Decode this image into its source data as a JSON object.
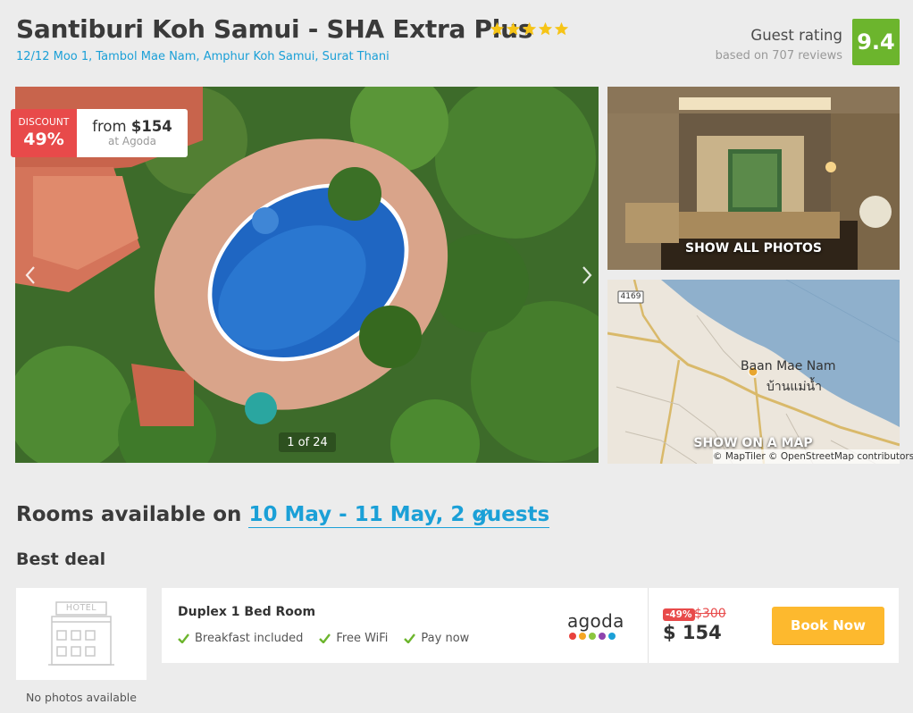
{
  "hotel": {
    "name": "Santiburi Koh Samui - SHA Extra Plus",
    "stars": 5,
    "address": "12/12 Moo 1, Tambol Mae Nam, Amphur Koh Samui, Surat Thani",
    "rating_label": "Guest rating",
    "rating_reviews": "based on 707 reviews",
    "rating_score": "9.4"
  },
  "gallery": {
    "discount_label": "DISCOUNT",
    "discount_pct": "49%",
    "from_price": "from $154",
    "from_source": "at Agoda",
    "counter": "1 of 24",
    "show_all_photos": "SHOW ALL PHOTOS",
    "show_on_map": "SHOW ON A MAP",
    "map_credit": "© MapTiler © OpenStreetMap contributors",
    "map_place_en": "Baan Mae Nam",
    "map_place_th": "บ้านแม่น้ำ",
    "map_road": "4169"
  },
  "rooms": {
    "title_prefix": "Rooms available on ",
    "title_dates": "10 May - 11 May, 2 guests",
    "best_deal": "Best deal",
    "thumb_sign": "HOTEL",
    "no_photos": "No photos available"
  },
  "deal": {
    "room_name": "Duplex 1 Bed Room",
    "amenities": [
      "Breakfast included",
      "Free WiFi",
      "Pay now"
    ],
    "provider": "agoda",
    "discount": "-49%",
    "old_price": "$300",
    "new_price": "$ 154",
    "book_label": "Book Now"
  },
  "colors": {
    "accent": "#1ba0d7",
    "rating_green": "#6cb52d",
    "discount_red": "#e84a4a",
    "book_yellow": "#fdb92e",
    "check_green": "#6cb52d",
    "agoda_dots": [
      "#e8413c",
      "#f5a623",
      "#8cc63f",
      "#8e44ad",
      "#1ba0d7"
    ]
  }
}
